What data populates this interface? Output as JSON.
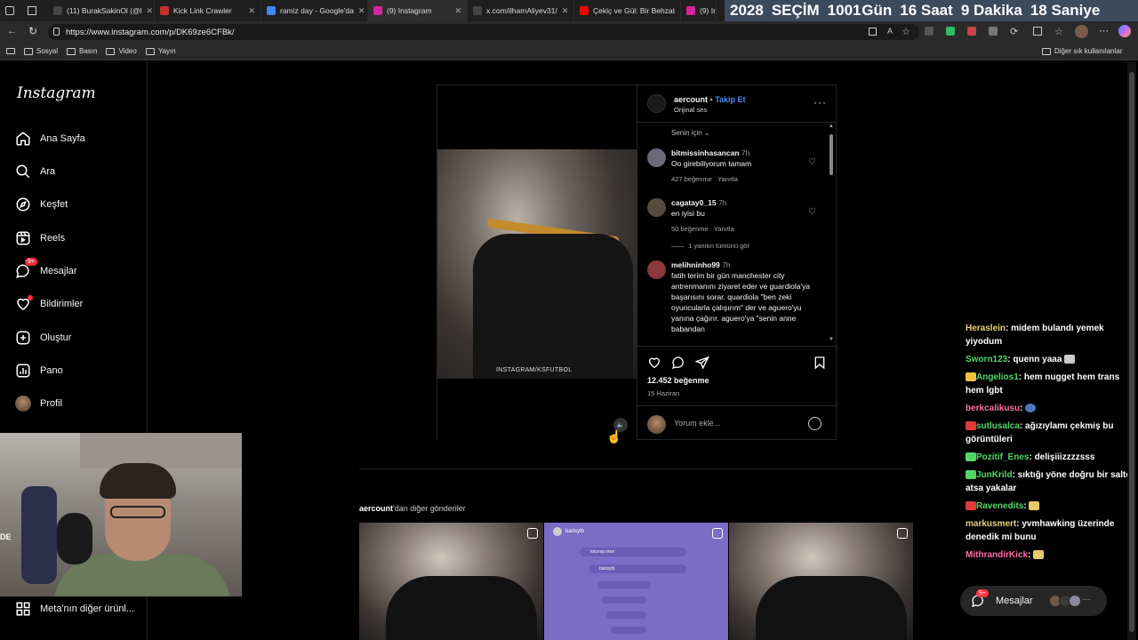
{
  "browser": {
    "tabs": [
      {
        "label": "(11) BurakSakinOl (@l",
        "color": "#444"
      },
      {
        "label": "Kick Link Crawler",
        "color": "#c4302b"
      },
      {
        "label": "ramiz day - Google'da",
        "color": "#4285f4"
      },
      {
        "label": "(9) Instagram",
        "color": "#d6249f"
      },
      {
        "label": "x.com/ilhamAliyev31/",
        "color": "#444"
      },
      {
        "label": "Çekiç ve Gül: Bir Behzat",
        "color": "#ff0000"
      },
      {
        "label": "(9) In",
        "color": "#d6249f"
      }
    ],
    "url": "https://www.instagram.com/p/DK69ze6CFBk/",
    "bookmarks": [
      "Sosyal",
      "Basın",
      "Video",
      "Yayın"
    ],
    "other_bookmarks": "Diğer sık kullanılanlar"
  },
  "countdown": {
    "year": "2028",
    "label": "SEÇİM",
    "days": "1001",
    "days_unit": "Gün",
    "hours": "16",
    "hours_unit": "Saat",
    "minutes": "9",
    "minutes_unit": "Dakika",
    "seconds": "18",
    "seconds_unit": "Saniye"
  },
  "sidebar": {
    "logo": "Instagram",
    "items": [
      {
        "label": "Ana Sayfa",
        "icon": "home-icon"
      },
      {
        "label": "Ara",
        "icon": "search-icon"
      },
      {
        "label": "Keşfet",
        "icon": "compass-icon"
      },
      {
        "label": "Reels",
        "icon": "reels-icon"
      },
      {
        "label": "Mesajlar",
        "icon": "messenger-icon",
        "badge": "9+"
      },
      {
        "label": "Bildirimler",
        "icon": "heart-icon"
      },
      {
        "label": "Oluştur",
        "icon": "plus-icon"
      },
      {
        "label": "Pano",
        "icon": "dashboard-icon"
      },
      {
        "label": "Profil",
        "icon": "avatar-icon"
      }
    ],
    "meta": "Meta'nın diğer ürünl..."
  },
  "post": {
    "author": "aercount",
    "follow": "Takip Et",
    "audio": "Orijinal ses",
    "watermark": "INSTAGRAM/KSFUTBOL",
    "sort": "Senin için",
    "comments": [
      {
        "user": "bitmissinhasancan",
        "time": "7h",
        "text": "Oo girebiliyorum tamam",
        "likes": "427 beğenme",
        "reply": "Yanıtla"
      },
      {
        "user": "cagatay0_15",
        "time": "7h",
        "text": "en iyisi bu",
        "likes": "50 beğenme",
        "reply": "Yanıtla"
      },
      {
        "user": "melihninho99",
        "time": "7h",
        "text": "fatih terim bir gün manchester city antrenmanını ziyaret eder ve guardiola'ya başarısını sorar. quardiola \"ben zeki oyuncularla çalışırım\" der ve aguero'yu yanına çağırır. aguero'ya \"senin anne babandan"
      }
    ],
    "view_replies": "1 yanıtın tümünü gör",
    "like_count": "12.452 beğenme",
    "date": "15 Haziran",
    "comment_placeholder": "Yorum ekle..."
  },
  "more_posts": {
    "author": "aercount",
    "suffix": "'dan diğer gönderiler",
    "tile2_user": "barisytb",
    "tile2_rows": [
      "tolunay.oren",
      "barisytb",
      "",
      "",
      "",
      ""
    ]
  },
  "chat": [
    {
      "user": "Heraslein",
      "color": "#e8d27a",
      "text": "midem bulandı yemek yiyodum"
    },
    {
      "user": "Sworn123",
      "color": "#53d769",
      "text": "quenn yaaa"
    },
    {
      "user": "Angelios1",
      "color": "#53d769",
      "text": "hem nugget hem trans hem lgbt",
      "emote": "#f0c040"
    },
    {
      "user": "berkcalikusu",
      "color": "#ff6fa6",
      "text": ""
    },
    {
      "user": "sutlusalca",
      "color": "#53d769",
      "text": "ağızıylamı çekmiş bu görüntüleri",
      "emote": "#e03a3a"
    },
    {
      "user": "Pozitif_Enes",
      "color": "#53d769",
      "text": "delişiiizzzzsss",
      "emote": "#53d769"
    },
    {
      "user": "JunKrild",
      "color": "#53d769",
      "text": "sıktığı yöne doğru bir salto atsa yakalar",
      "emote": "#53d769"
    },
    {
      "user": "Ravenedits",
      "color": "#53d769",
      "text": "",
      "emote": "#e03a3a"
    },
    {
      "user": "markusmert",
      "color": "#e8d27a",
      "text": "yvmhawking üzerinde denedik mi bunu"
    },
    {
      "user": "MithrandirKick",
      "color": "#ff6fa6",
      "text": ""
    }
  ],
  "dm": {
    "label": "Mesajlar",
    "badge": "9+"
  },
  "webcam_label": "DE"
}
